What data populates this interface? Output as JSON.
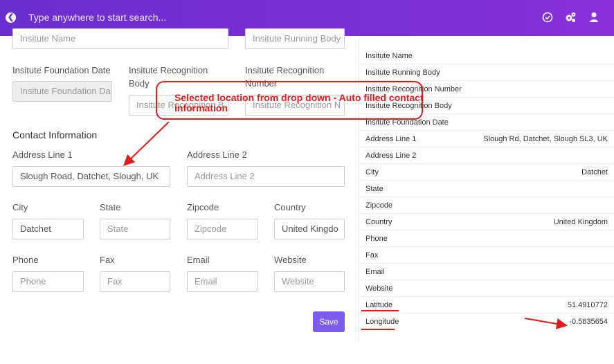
{
  "topbar": {
    "search_placeholder": "Type anywhere to start search..."
  },
  "form": {
    "fields": {
      "institute_name_ph": "Insitute Name",
      "running_body_ph": "Insitute Running Body",
      "foundation_label": "Insitute Foundation Date",
      "foundation_ph": "Insitute Foundation Da",
      "recognition_body_label": "Insitute Recognition Body",
      "recognition_body_ph": "Insitute Recognition B",
      "recognition_number_label": "Insitute Recognition Number",
      "recognition_number_ph": "Insitute Recognition N"
    },
    "contact_title": "Contact Information",
    "address1_label": "Address Line 1",
    "address1_value": "Slough Road, Datchet, Slough, UK",
    "address2_label": "Address Line 2",
    "address2_ph": "Address Line 2",
    "city_label": "City",
    "city_value": "Datchet",
    "state_label": "State",
    "state_ph": "State",
    "zip_label": "Zipcode",
    "zip_ph": "Zipcode",
    "country_label": "Country",
    "country_value": "United Kingdo",
    "phone_label": "Phone",
    "phone_ph": "Phone",
    "fax_label": "Fax",
    "fax_ph": "Fax",
    "email_label": "Email",
    "email_ph": "Email",
    "website_label": "Website",
    "website_ph": "Website",
    "save_label": "Save"
  },
  "summary": [
    {
      "key": "Insitute Name",
      "value": ""
    },
    {
      "key": "Insitute Running Body",
      "value": ""
    },
    {
      "key": "Insitute Recognition Number",
      "value": ""
    },
    {
      "key": "Insitute Recognition Body",
      "value": ""
    },
    {
      "key": "Insitute Foundation Date",
      "value": ""
    },
    {
      "key": "Address Line 1",
      "value": "Slough Rd, Datchet, Slough SL3, UK"
    },
    {
      "key": "Address Line 2",
      "value": ""
    },
    {
      "key": "City",
      "value": "Datchet"
    },
    {
      "key": "State",
      "value": ""
    },
    {
      "key": "Zipcode",
      "value": ""
    },
    {
      "key": "Country",
      "value": "United Kingdom"
    },
    {
      "key": "Phone",
      "value": ""
    },
    {
      "key": "Fax",
      "value": ""
    },
    {
      "key": "Email",
      "value": ""
    },
    {
      "key": "Website",
      "value": ""
    },
    {
      "key": "Latitude",
      "value": "51.4910772"
    },
    {
      "key": "Longitude",
      "value": "-0.5835654"
    }
  ],
  "annotation": {
    "callout_text": "Selected location from drop down - Auto filled contact information",
    "color": "#e21b1b"
  }
}
